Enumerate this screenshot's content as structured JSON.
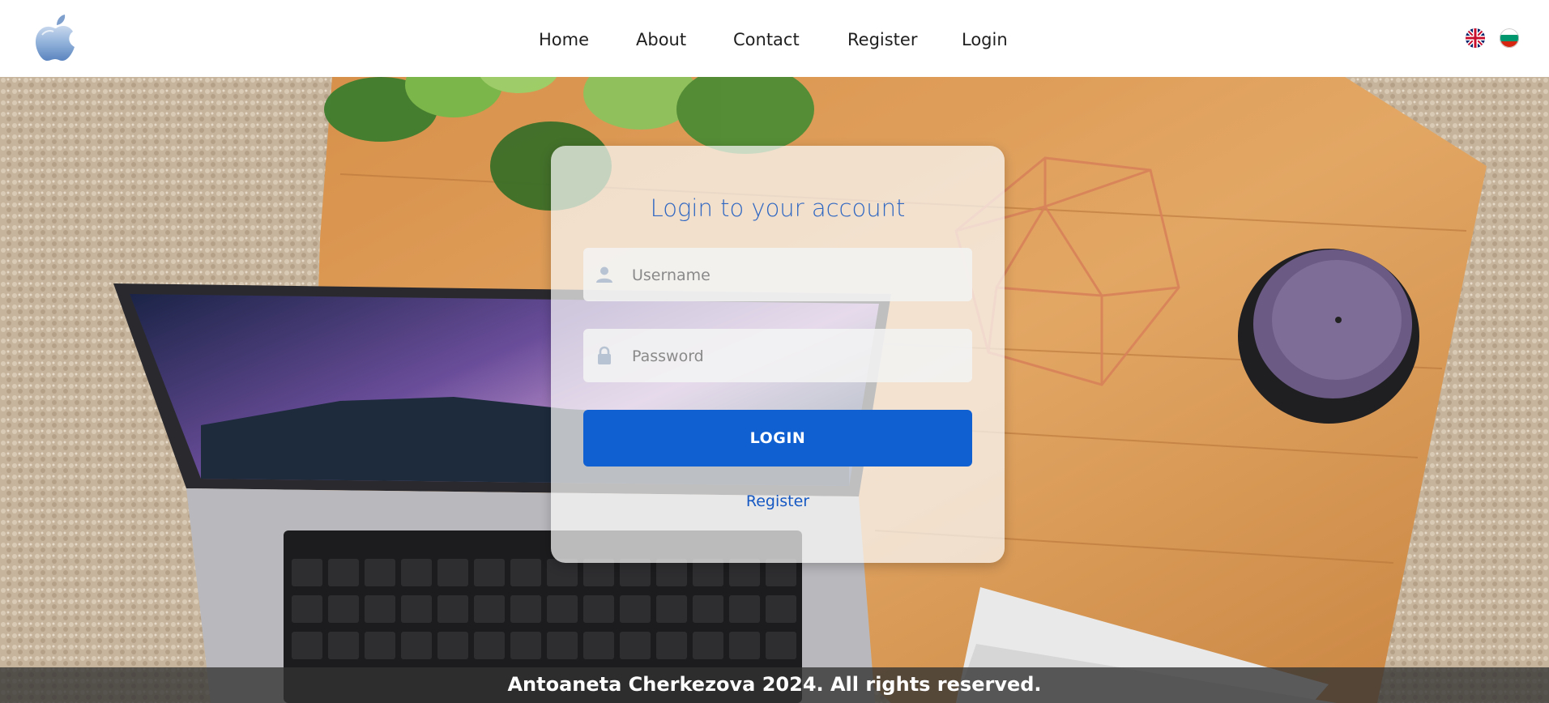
{
  "header": {
    "logo_icon": "apple-logo-icon",
    "nav": [
      "Home",
      "About",
      "Contact",
      "Register",
      "Login"
    ],
    "languages": [
      {
        "icon": "uk-flag-icon"
      },
      {
        "icon": "bulgaria-flag-icon"
      }
    ]
  },
  "login": {
    "title": "Login to your account",
    "username_placeholder": "Username",
    "username_icon": "user-icon",
    "password_placeholder": "Password",
    "password_icon": "lock-icon",
    "login_button": "LOGIN",
    "register_link": "Register"
  },
  "footer": {
    "text": "Antoaneta Cherkezova 2024. All rights reserved."
  },
  "colors": {
    "accent": "#1060d2",
    "title": "#2f67c2",
    "header_bg": "#ffffff",
    "footer_bg": "#323232"
  }
}
